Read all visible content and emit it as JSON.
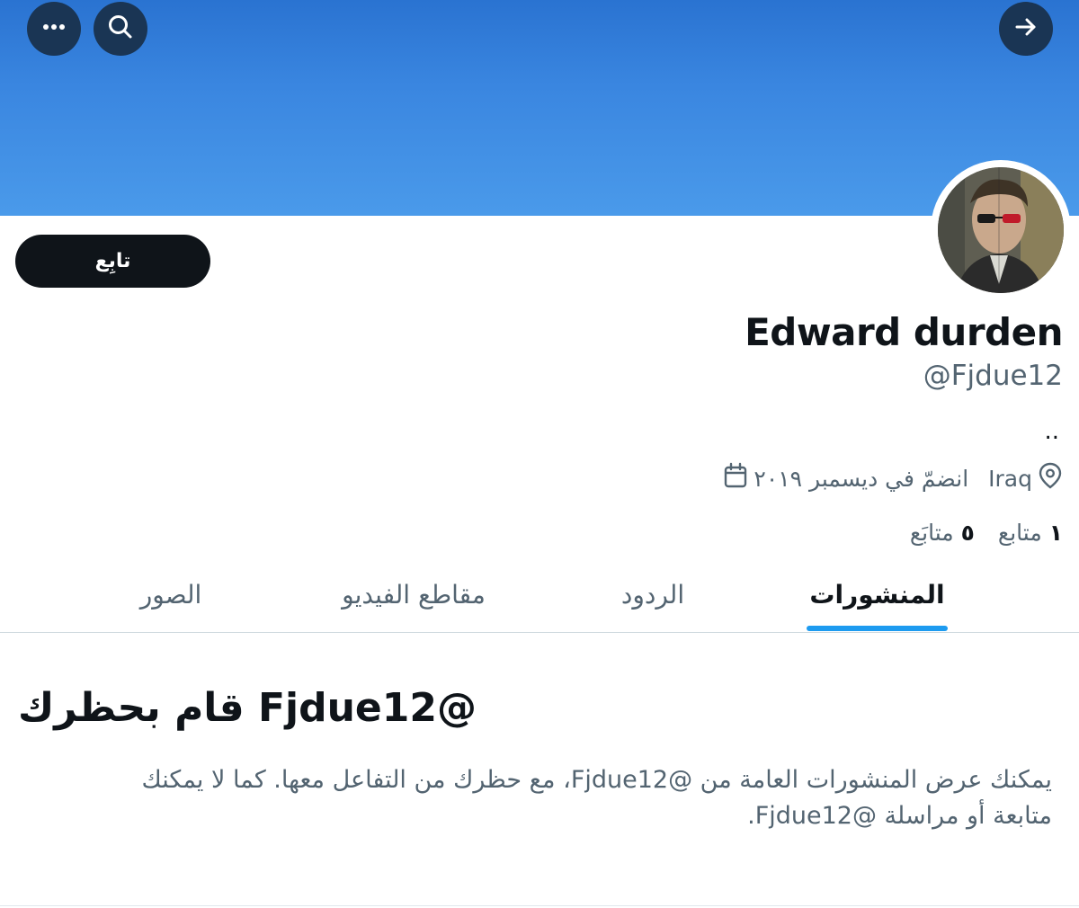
{
  "header": {
    "more_icon": "more-horizontal-icon",
    "search_icon": "search-icon",
    "back_icon": "arrow-right-icon",
    "banner_color": "#3a86e0"
  },
  "profile": {
    "display_name": "Edward durden",
    "handle": "@Fjdue12",
    "bio": "..",
    "location": "Iraq",
    "joined": "انضمّ في ديسمبر ٢٠١٩",
    "follow_label": "تابِع",
    "avatar_icon": "avatar"
  },
  "stats": {
    "following_count": "٥",
    "following_label": "متابَع",
    "followers_count": "١",
    "followers_label": "متابع"
  },
  "tabs": [
    {
      "label": "المنشورات",
      "active": true
    },
    {
      "label": "الردود",
      "active": false
    },
    {
      "label": "مقاطع الفيديو",
      "active": false
    },
    {
      "label": "الصور",
      "active": false
    }
  ],
  "blocked": {
    "title": "@Fjdue12 قام بحظرك",
    "description": "يمكنك عرض المنشورات العامة من @Fjdue12، مع حظرك من التفاعل معها. كما لا يمكنك متابعة أو مراسلة @Fjdue12."
  },
  "colors": {
    "accent": "#1d9bf0",
    "text_primary": "#0f1419",
    "text_secondary": "#536471"
  }
}
